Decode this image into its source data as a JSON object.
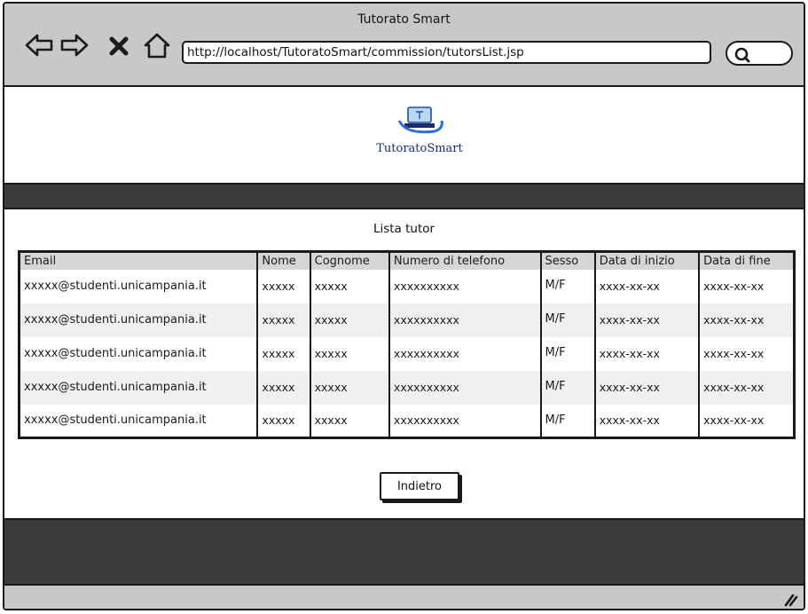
{
  "window": {
    "title": "Tutorato Smart"
  },
  "browser": {
    "url": "http://localhost/TutoratoSmart/commission/tutorsList.jsp"
  },
  "header": {
    "logo_text": "TutoratoSmart"
  },
  "main": {
    "list_title": "Lista tutor",
    "table": {
      "columns": [
        "Email",
        "Nome",
        "Cognome",
        "Numero di telefono",
        "Sesso",
        "Data di inizio",
        "Data di fine"
      ],
      "rows": [
        [
          "xxxxx@studenti.unicampania.it",
          "xxxxx",
          "xxxxx",
          "xxxxxxxxxx",
          "M/F",
          "xxxx-xx-xx",
          "xxxx-xx-xx"
        ],
        [
          "xxxxx@studenti.unicampania.it",
          "xxxxx",
          "xxxxx",
          "xxxxxxxxxx",
          "M/F",
          "xxxx-xx-xx",
          "xxxx-xx-xx"
        ],
        [
          "xxxxx@studenti.unicampania.it",
          "xxxxx",
          "xxxxx",
          "xxxxxxxxxx",
          "M/F",
          "xxxx-xx-xx",
          "xxxx-xx-xx"
        ],
        [
          "xxxxx@studenti.unicampania.it",
          "xxxxx",
          "xxxxx",
          "xxxxxxxxxx",
          "M/F",
          "xxxx-xx-xx",
          "xxxx-xx-xx"
        ],
        [
          "xxxxx@studenti.unicampania.it",
          "xxxxx",
          "xxxxx",
          "xxxxxxxxxx",
          "M/F",
          "xxxx-xx-xx",
          "xxxx-xx-xx"
        ]
      ]
    },
    "back_label": "Indietro"
  },
  "icons": {
    "back": "arrow-left-icon",
    "forward": "arrow-right-icon",
    "stop": "close-icon",
    "home": "home-icon",
    "search": "search-icon",
    "resize": "resize-grip-icon"
  },
  "colors": {
    "chrome": "#c8c8c8",
    "dark_bar": "#3b3b3b",
    "table_header": "#d6d6d6",
    "logo_text": "#1f2a6a"
  }
}
